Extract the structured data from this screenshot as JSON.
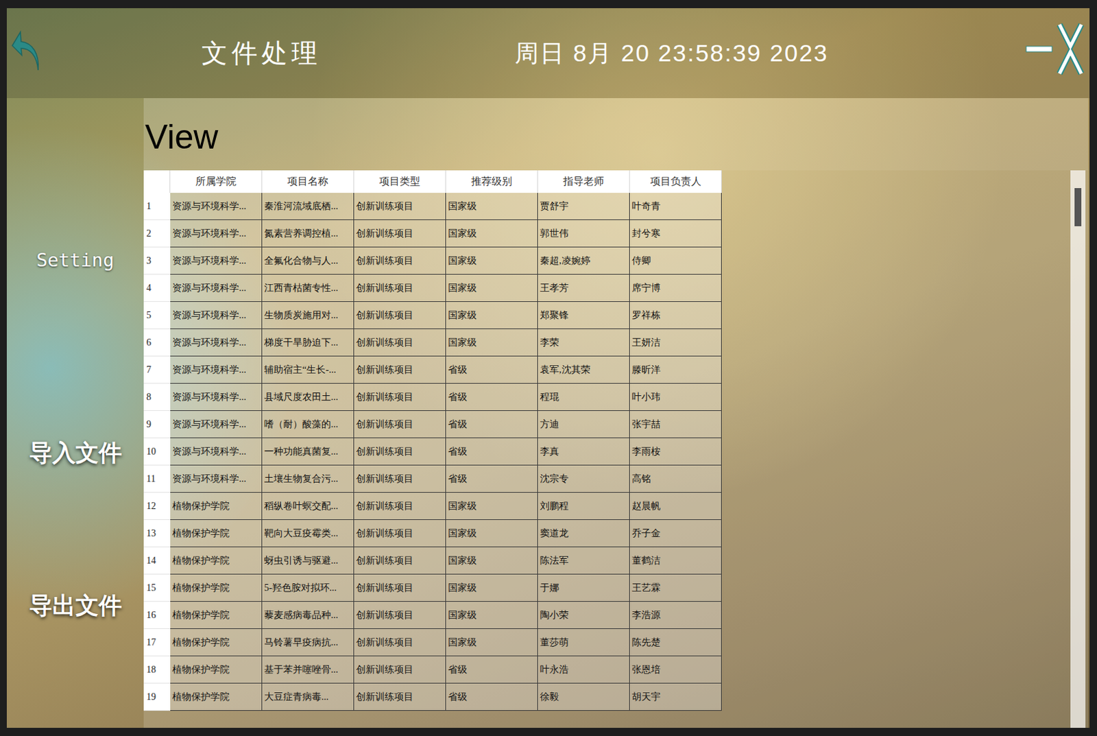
{
  "window": {
    "title": "文件处理",
    "datetime": "周日 8月 20 23:58:39 2023"
  },
  "sidebar": {
    "items": [
      {
        "label": "Setting",
        "kind": "link"
      },
      {
        "label": "导入文件",
        "kind": "action"
      },
      {
        "label": "导出文件",
        "kind": "action"
      }
    ]
  },
  "view": {
    "heading": "View"
  },
  "table": {
    "columns": [
      "所属学院",
      "项目名称",
      "项目类型",
      "推荐级别",
      "指导老师",
      "项目负责人"
    ],
    "rows": [
      {
        "index": "1",
        "cells": [
          "资源与环境科学...",
          "秦淮河流域底栖...",
          "创新训练项目",
          "国家级",
          "贾舒宇",
          "叶奇青"
        ]
      },
      {
        "index": "2",
        "cells": [
          "资源与环境科学...",
          "氮素营养调控植...",
          "创新训练项目",
          "国家级",
          "郭世伟",
          "封兮寒"
        ]
      },
      {
        "index": "3",
        "cells": [
          "资源与环境科学...",
          "全氟化合物与人...",
          "创新训练项目",
          "国家级",
          "秦超,凌婉婷",
          "侍卿"
        ]
      },
      {
        "index": "4",
        "cells": [
          "资源与环境科学...",
          "江西青枯菌专性...",
          "创新训练项目",
          "国家级",
          "王孝芳",
          "席宁博"
        ]
      },
      {
        "index": "5",
        "cells": [
          "资源与环境科学...",
          "生物质炭施用对...",
          "创新训练项目",
          "国家级",
          "郑聚锋",
          "罗祥栋"
        ]
      },
      {
        "index": "6",
        "cells": [
          "资源与环境科学...",
          "梯度干旱胁迫下...",
          "创新训练项目",
          "国家级",
          "李荣",
          "王妍洁"
        ]
      },
      {
        "index": "7",
        "cells": [
          "资源与环境科学...",
          "辅助宿主“生长-...",
          "创新训练项目",
          "省级",
          "袁军,沈其荣",
          "滕昕洋"
        ]
      },
      {
        "index": "8",
        "cells": [
          "资源与环境科学...",
          "县域尺度农田土...",
          "创新训练项目",
          "省级",
          "程琨",
          "叶小玮"
        ]
      },
      {
        "index": "9",
        "cells": [
          "资源与环境科学...",
          "嗜（耐）酸藻的...",
          "创新训练项目",
          "省级",
          "方迪",
          "张宇喆"
        ]
      },
      {
        "index": "10",
        "cells": [
          "资源与环境科学...",
          "一种功能真菌复...",
          "创新训练项目",
          "省级",
          "李真",
          "李雨桉"
        ]
      },
      {
        "index": "11",
        "cells": [
          "资源与环境科学...",
          "土壤生物复合污...",
          "创新训练项目",
          "省级",
          "沈宗专",
          "高铭"
        ]
      },
      {
        "index": "12",
        "cells": [
          "植物保护学院",
          "稻纵卷叶螟交配...",
          "创新训练项目",
          "国家级",
          "刘鹏程",
          "赵晨帆"
        ]
      },
      {
        "index": "13",
        "cells": [
          "植物保护学院",
          "靶向大豆疫霉类...",
          "创新训练项目",
          "国家级",
          "窦道龙",
          "乔子金"
        ]
      },
      {
        "index": "14",
        "cells": [
          "植物保护学院",
          "蚜虫引诱与驱避...",
          "创新训练项目",
          "国家级",
          "陈法军",
          "董鹤洁"
        ]
      },
      {
        "index": "15",
        "cells": [
          "植物保护学院",
          "5-羟色胺对拟环...",
          "创新训练项目",
          "国家级",
          "于娜",
          "王艺霖"
        ]
      },
      {
        "index": "16",
        "cells": [
          "植物保护学院",
          "藜麦感病毒品种...",
          "创新训练项目",
          "国家级",
          "陶小荣",
          "李浩源"
        ]
      },
      {
        "index": "17",
        "cells": [
          "植物保护学院",
          "马铃薯早疫病抗...",
          "创新训练项目",
          "国家级",
          "董莎萌",
          "陈先楚"
        ]
      },
      {
        "index": "18",
        "cells": [
          "植物保护学院",
          "基于苯并噻唑骨...",
          "创新训练项目",
          "省级",
          "叶永浩",
          "张恩培"
        ]
      },
      {
        "index": "19",
        "cells": [
          "植物保护学院",
          "大豆症青病毒...",
          "创新训练项目",
          "省级",
          "徐毅",
          "胡天宇"
        ]
      }
    ]
  }
}
